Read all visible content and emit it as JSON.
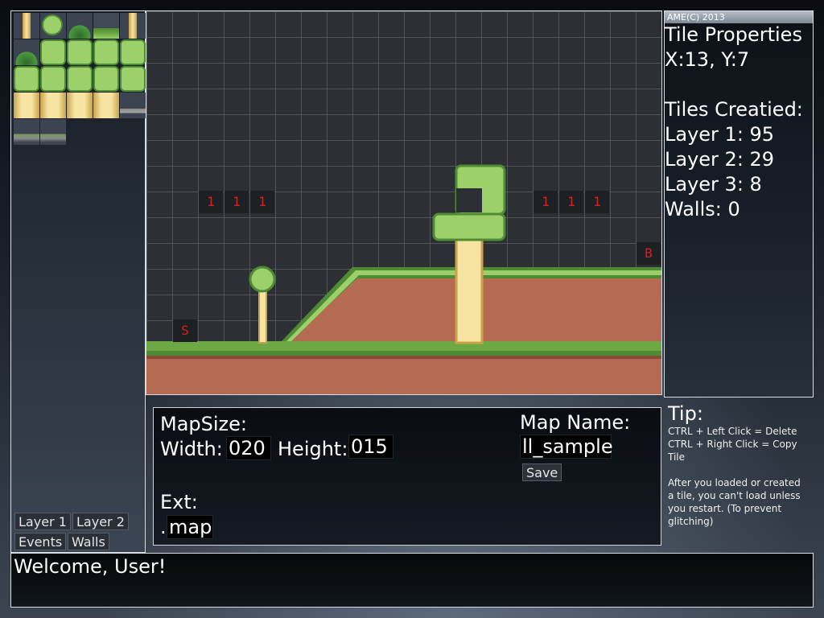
{
  "colors": {
    "grass_light": "#9bd06a",
    "grass_dark": "#4f8a35",
    "dirt": "#b56b52",
    "pole": "#f7e4a2",
    "marker_text": "#d42020",
    "grid_bg": "#2c2f33"
  },
  "palette": {
    "layer_buttons": [
      "Layer 1",
      "Layer 2",
      "Events",
      "Walls"
    ]
  },
  "map": {
    "markers": [
      "1",
      "1",
      "1",
      "1",
      "1",
      "1",
      "S",
      "B"
    ]
  },
  "properties": {
    "header": "AME(C) 2013",
    "title": "Tile Properties",
    "coords": "X:13, Y:7",
    "tiles_created_label": "Tiles Creatied:",
    "layer1": "Layer 1: 95",
    "layer2": "Layer 2: 29",
    "layer3": "Layer 3: 8",
    "walls": "Walls: 0"
  },
  "settings": {
    "mapsize_label": "MapSize:",
    "width_label": "Width:",
    "width_value": "020",
    "height_label": "Height:",
    "height_value": "015",
    "ext_label": "Ext:",
    "ext_dot": ".",
    "ext_value": "map",
    "map_name_label": "Map Name:",
    "map_name_value": "ll_sample",
    "save_label": "Save"
  },
  "tip": {
    "title": "Tip:",
    "line1": "CTRL + Left Click = Delete",
    "line2": "CTRL + Right Click = Copy Tile",
    "line3": "After you loaded or created",
    "line4": "a tile, you can't load unless",
    "line5": "you restart. (To prevent",
    "line6": "glitching)"
  },
  "status": {
    "message": "Welcome, User!"
  }
}
